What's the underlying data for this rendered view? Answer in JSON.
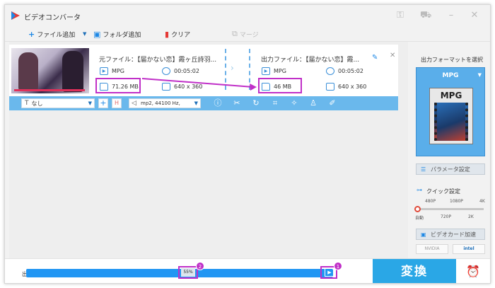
{
  "window": {
    "title": "ビデオコンバータ"
  },
  "toolbar": {
    "add_file": "ファイル追加",
    "add_folder": "フォルダ追加",
    "clear": "クリア",
    "merge": "マージ"
  },
  "task": {
    "source": {
      "name": "元ファイル：【届かない恋】霞ヶ丘詩羽...",
      "format": "MPG",
      "duration": "00:05:02",
      "size": "71.26 MB",
      "resolution": "640 x 360"
    },
    "output": {
      "name": "出力ファイル：【届かない恋】霞...",
      "format": "MPG",
      "duration": "00:05:02",
      "size": "46 MB",
      "resolution": "640 x 360"
    },
    "subtitle": "なし",
    "audio": "mp2, 44100 Hz,"
  },
  "sidebar": {
    "format_title": "出力フォーマットを選択",
    "format_value": "MPG",
    "format_file_label": "MPG",
    "params_button": "パラメータ設定",
    "quick_title": "クイック設定",
    "quick_top_ticks": [
      "480P",
      "1080P",
      "4K"
    ],
    "quick_bottom_ticks": [
      "自動",
      "720P",
      "2K"
    ],
    "quick_level": 0,
    "gpu_button": "ビデオカード加速",
    "nvidia_label": "NVIDIA",
    "intel_label": "intel"
  },
  "bottom": {
    "output_label": "出",
    "progress": "55%",
    "progress_value": 0.55,
    "badge_1": "1",
    "badge_2": "2",
    "convert": "変換"
  },
  "colors": {
    "accent": "#2196f3",
    "highlight": "#c030c8",
    "convert_button": "#2aa7e6"
  },
  "icons": [
    "app-logo-icon",
    "key-icon",
    "cart-icon",
    "minimize-icon",
    "close-icon",
    "plus-icon",
    "folder-icon",
    "trash-icon",
    "merge-icon",
    "edit-icon",
    "info-icon",
    "scissors-icon",
    "rotate-icon",
    "crop-icon",
    "magic-icon",
    "stamp-icon",
    "pen-icon",
    "speaker-icon",
    "alarm-icon"
  ]
}
